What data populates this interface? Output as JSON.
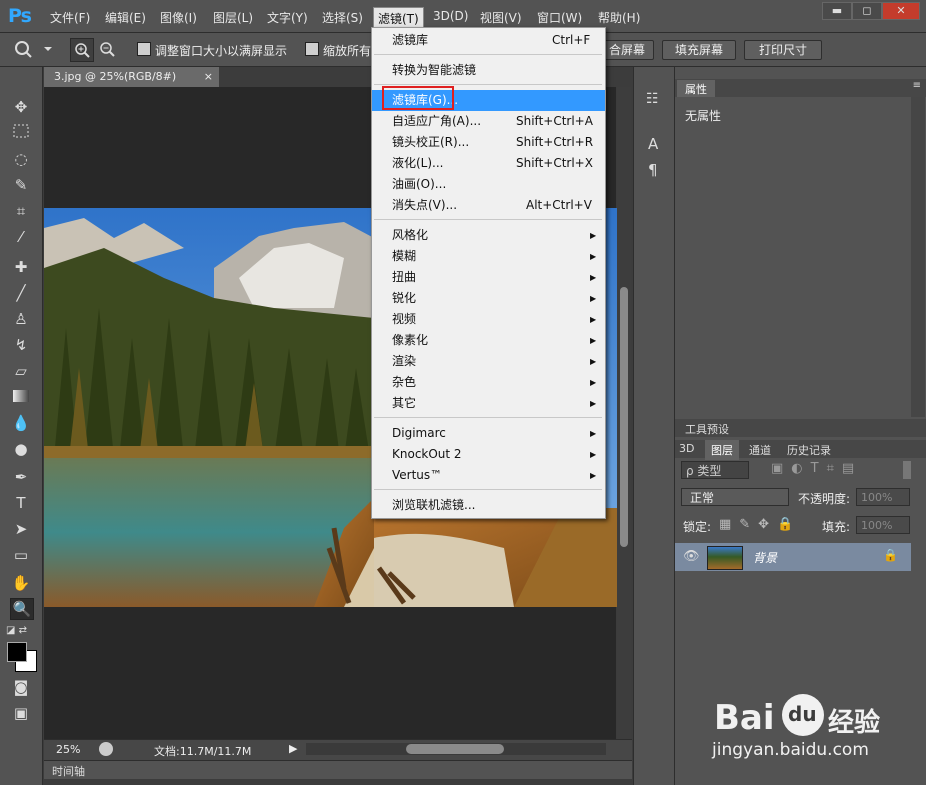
{
  "menubar": {
    "logo": "Ps",
    "items": [
      "文件(F)",
      "编辑(E)",
      "图像(I)",
      "图层(L)",
      "文字(Y)",
      "选择(S)",
      "滤镜(T)",
      "3D(D)",
      "视图(V)",
      "窗口(W)",
      "帮助(H)"
    ],
    "window_buttons": [
      "▬",
      "◻",
      "✕"
    ]
  },
  "options": {
    "checkbox1": "调整窗口大小以满屏显示",
    "checkbox2": "缩放所有",
    "btn_fit": "合屏幕",
    "btn_fill": "填充屏幕",
    "btn_print": "打印尺寸"
  },
  "document": {
    "tab_title": "3.jpg @ 25%(RGB/8#)",
    "tab_close": "×",
    "zoom": "25%",
    "doc_info": "文档:11.7M/11.7M",
    "timeline": "时间轴"
  },
  "filter_menu": {
    "last_filter": {
      "label": "滤镜库",
      "shortcut": "Ctrl+F"
    },
    "smart": "转换为智能滤镜",
    "group1": [
      {
        "label": "滤镜库(G)...",
        "shortcut": ""
      },
      {
        "label": "自适应广角(A)...",
        "shortcut": "Shift+Ctrl+A"
      },
      {
        "label": "镜头校正(R)...",
        "shortcut": "Shift+Ctrl+R"
      },
      {
        "label": "液化(L)...",
        "shortcut": "Shift+Ctrl+X"
      },
      {
        "label": "油画(O)...",
        "shortcut": ""
      },
      {
        "label": "消失点(V)...",
        "shortcut": "Alt+Ctrl+V"
      }
    ],
    "group2": [
      "风格化",
      "模糊",
      "扭曲",
      "锐化",
      "视频",
      "像素化",
      "渲染",
      "杂色",
      "其它"
    ],
    "group3": [
      "Digimarc",
      "KnockOut 2",
      "Vertus™"
    ],
    "browse": "浏览联机滤镜..."
  },
  "properties": {
    "tab": "属性",
    "content": "无属性"
  },
  "tool_presets": {
    "tab": "工具预设"
  },
  "layers_panel": {
    "tabs": [
      "3D",
      "图层",
      "通道",
      "历史记录"
    ],
    "kind": "ρ 类型",
    "blend_mode": "正常",
    "opacity_label": "不透明度:",
    "opacity_value": "100%",
    "lock_label": "锁定:",
    "fill_label": "填充:",
    "fill_value": "100%",
    "layer_name": "背景"
  },
  "watermark": {
    "brand": "Bai",
    "paw": "du",
    "cn": "经验",
    "url": "jingyan.baidu.com"
  },
  "colors": {
    "highlight": "#3399ff",
    "red_box": "#e02020"
  }
}
